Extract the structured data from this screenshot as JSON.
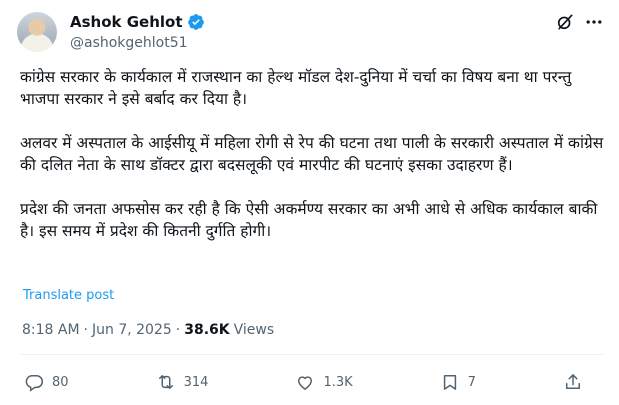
{
  "author": {
    "name": "Ashok Gehlot",
    "handle": "@ashokgehlot51"
  },
  "post": {
    "paragraphs": [
      "कांग्रेस सरकार के कार्यकाल में राजस्थान का हेल्थ मॉडल देश-दुनिया में चर्चा का विषय बना था परन्तु भाजपा सरकार ने इसे बर्बाद कर दिया है।",
      "अलवर में अस्पताल के आईसीयू में महिला रोगी से रेप की घटना तथा पाली के सरकारी अस्पताल में कांग्रेस की दलित नेता के साथ डॉक्टर द्वारा बदसलूकी एवं मारपीट की घटनाएं इसका उदाहरण हैं।",
      "प्रदेश की जनता अफसोस कर रही है कि ऐसी अकर्मण्य सरकार का अभी आधे से अधिक कार्यकाल बाकी है। इस समय में प्रदेश की कितनी दुर्गति होगी।"
    ],
    "translate_label": "Translate post"
  },
  "meta": {
    "time": "8:18 AM",
    "separator": "·",
    "date": "Jun 7, 2025",
    "views_count": "38.6K",
    "views_label": "Views"
  },
  "actions": {
    "replies": "80",
    "reposts": "314",
    "likes": "1.3K",
    "bookmarks": "7"
  },
  "colors": {
    "accent": "#1d9bf0",
    "secondary_text": "#536471",
    "primary_text": "#0f1419"
  },
  "icons": [
    "verified-badge-icon",
    "grok-icon",
    "more-icon",
    "reply-icon",
    "repost-icon",
    "like-icon",
    "bookmark-icon",
    "share-icon"
  ]
}
